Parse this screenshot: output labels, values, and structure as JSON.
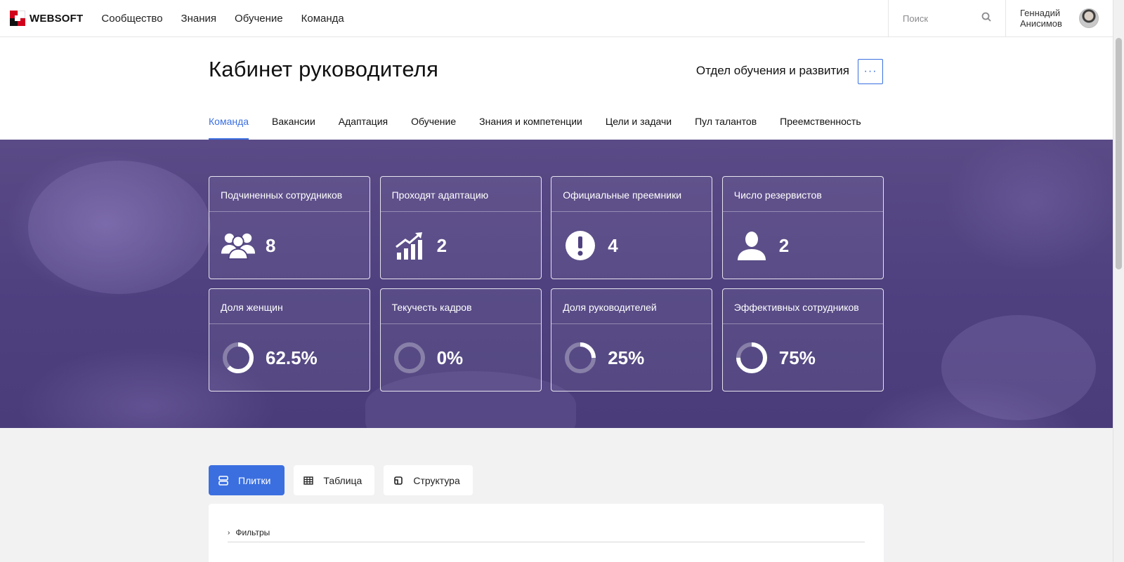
{
  "brand": {
    "name": "WEBSOFT",
    "accent": "#3b6fe0"
  },
  "topnav": {
    "items": [
      {
        "label": "Сообщество"
      },
      {
        "label": "Знания"
      },
      {
        "label": "Обучение"
      },
      {
        "label": "Команда"
      }
    ]
  },
  "search": {
    "placeholder": "Поиск",
    "icon": "search-icon"
  },
  "user": {
    "first_name": "Геннадий",
    "last_name": "Анисимов"
  },
  "header": {
    "title": "Кабинет руководителя",
    "department": "Отдел обучения и развития",
    "more_label": "···"
  },
  "tabs": [
    {
      "label": "Команда",
      "active": true
    },
    {
      "label": "Вакансии"
    },
    {
      "label": "Адаптация"
    },
    {
      "label": "Обучение"
    },
    {
      "label": "Знания и компетенции"
    },
    {
      "label": "Цели и задачи"
    },
    {
      "label": "Пул талантов"
    },
    {
      "label": "Преемственность"
    }
  ],
  "stats": [
    {
      "title": "Подчиненных сотрудников",
      "value": "8",
      "icon": "group-icon"
    },
    {
      "title": "Проходят адаптацию",
      "value": "2",
      "icon": "growth-chart-icon"
    },
    {
      "title": "Официальные преемники",
      "value": "4",
      "icon": "exclamation-icon"
    },
    {
      "title": "Число резервистов",
      "value": "2",
      "icon": "person-icon"
    },
    {
      "title": "Доля женщин",
      "value": "62.5%",
      "icon": "donut-icon",
      "fraction": 0.625
    },
    {
      "title": "Текучесть кадров",
      "value": "0%",
      "icon": "donut-icon",
      "fraction": 0
    },
    {
      "title": "Доля руководителей",
      "value": "25%",
      "icon": "donut-icon",
      "fraction": 0.25
    },
    {
      "title": "Эффективных сотрудников",
      "value": "75%",
      "icon": "donut-icon",
      "fraction": 0.75
    }
  ],
  "views": [
    {
      "label": "Плитки",
      "active": true,
      "icon": "tiles-icon"
    },
    {
      "label": "Таблица",
      "icon": "table-icon"
    },
    {
      "label": "Структура",
      "icon": "structure-icon"
    }
  ],
  "filters": {
    "label": "Фильтры"
  }
}
